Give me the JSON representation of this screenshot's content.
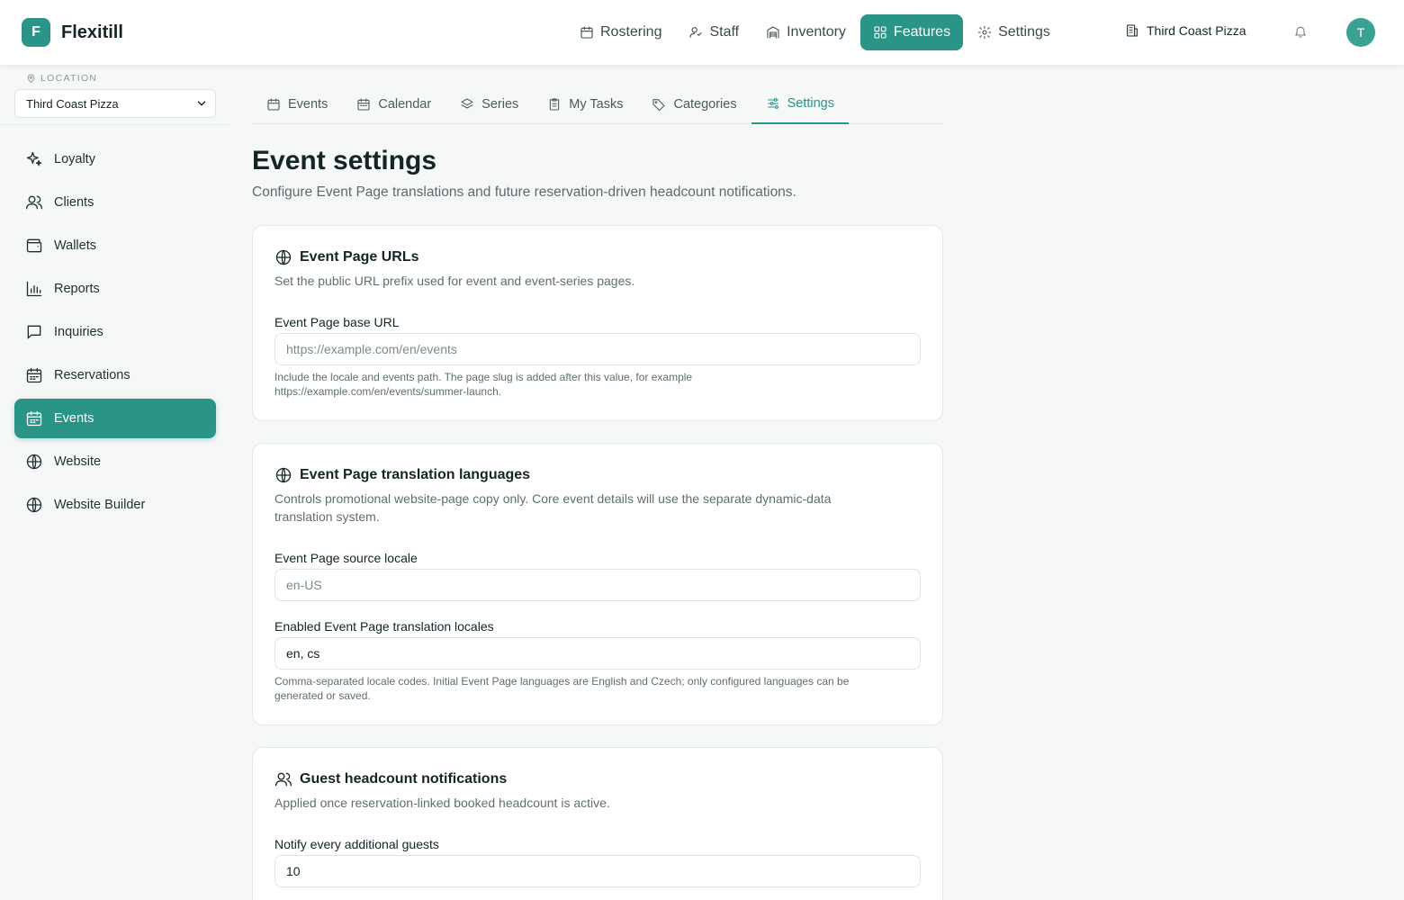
{
  "app": {
    "logo_letter": "F",
    "name": "Flexitill"
  },
  "topnav": {
    "items": [
      {
        "label": "Rostering",
        "icon": "calendar-icon"
      },
      {
        "label": "Staff",
        "icon": "user-icon"
      },
      {
        "label": "Inventory",
        "icon": "warehouse-icon"
      },
      {
        "label": "Features",
        "icon": "grid-icon"
      },
      {
        "label": "Settings",
        "icon": "gear-icon"
      }
    ],
    "location": "Third Coast Pizza",
    "avatar_letter": "T"
  },
  "sidebar": {
    "location_label": "LOCATION",
    "location_value": "Third Coast Pizza",
    "items": [
      {
        "label": "Loyalty",
        "icon": "sparkles-icon"
      },
      {
        "label": "Clients",
        "icon": "users-icon"
      },
      {
        "label": "Wallets",
        "icon": "wallet-icon"
      },
      {
        "label": "Reports",
        "icon": "bar-chart-icon"
      },
      {
        "label": "Inquiries",
        "icon": "message-icon"
      },
      {
        "label": "Reservations",
        "icon": "calendar-icon"
      },
      {
        "label": "Events",
        "icon": "calendar-icon"
      },
      {
        "label": "Website",
        "icon": "globe-icon"
      },
      {
        "label": "Website Builder",
        "icon": "globe-icon"
      }
    ]
  },
  "tabs": [
    {
      "label": "Events",
      "icon": "calendar-icon"
    },
    {
      "label": "Calendar",
      "icon": "calendar-icon"
    },
    {
      "label": "Series",
      "icon": "layers-icon"
    },
    {
      "label": "My Tasks",
      "icon": "clipboard-icon"
    },
    {
      "label": "Categories",
      "icon": "tag-icon"
    },
    {
      "label": "Settings",
      "icon": "sliders-icon"
    }
  ],
  "page": {
    "title": "Event settings",
    "subtitle": "Configure Event Page translations and future reservation-driven headcount notifications."
  },
  "cards": {
    "urls": {
      "title": "Event Page URLs",
      "description": "Set the public URL prefix used for event and event-series pages.",
      "base_url_label": "Event Page base URL",
      "base_url_value": "",
      "base_url_placeholder": "https://example.com/en/events",
      "help_line1": "Include the locale and events path. The page slug is added after this value, for example",
      "help_line2": "https://example.com/en/events/summer-launch."
    },
    "languages": {
      "title": "Event Page translation languages",
      "description_line1": "Controls promotional website-page copy only. Core event details will use the separate dynamic-data",
      "description_line2": "translation system.",
      "source_label": "Event Page source locale",
      "source_value": "",
      "source_placeholder": "en-US",
      "enabled_label": "Enabled Event Page translation locales",
      "enabled_value": "en, cs",
      "help_line1": "Comma-separated locale codes. Initial Event Page languages are English and Czech; only configured languages can be",
      "help_line2": "generated or saved."
    },
    "headcount": {
      "title": "Guest headcount notifications",
      "description": "Applied once reservation-linked booked headcount is active.",
      "notify_label": "Notify every additional guests",
      "notify_value": "10"
    }
  },
  "colors": {
    "accent": "#2a9486",
    "background": "#f6f7f7"
  }
}
